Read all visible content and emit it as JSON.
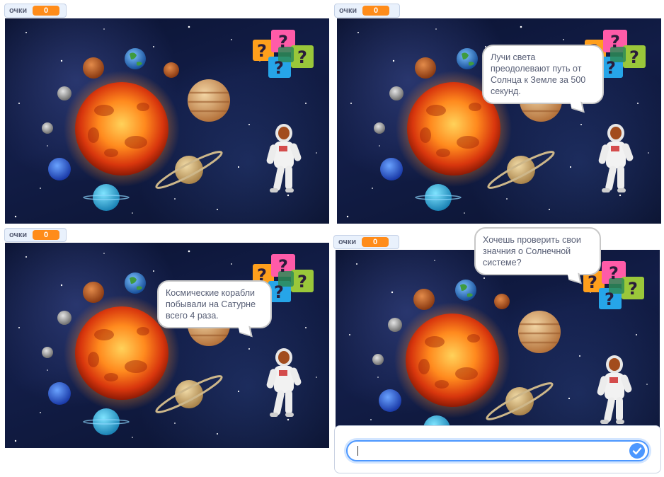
{
  "panels": [
    {
      "monitor_label": "очки",
      "monitor_value": "0",
      "bubble_text": ""
    },
    {
      "monitor_label": "очки",
      "monitor_value": "0",
      "bubble_text": "Лучи света преодолевают путь от Солнца к Земле за 500 секунд."
    },
    {
      "monitor_label": "очки",
      "monitor_value": "0",
      "bubble_text": "Космические корабли побывали на Сатурне всего 4 раза."
    },
    {
      "monitor_label": "очки",
      "monitor_value": "0",
      "bubble_text": "Хочешь проверить свои значния о Солнечной системе?"
    }
  ],
  "ask": {
    "input_value": ""
  },
  "icons": [
    "check-icon",
    "question-speech-bubbles-icon"
  ],
  "colors": {
    "monitor_value_bg": "#ff8c1a",
    "accent": "#4c97ff"
  }
}
